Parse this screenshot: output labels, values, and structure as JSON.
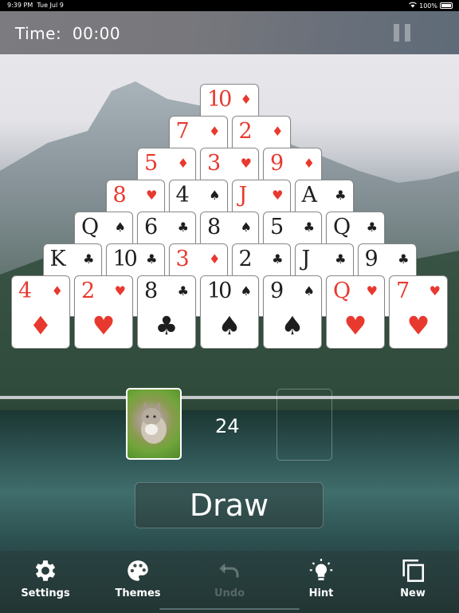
{
  "status_bar": {
    "time": "9:39 PM",
    "date": "Tue Jul 9",
    "battery": "100%"
  },
  "header": {
    "time_label": "Time:",
    "time_value": "00:00"
  },
  "pyramid": {
    "rows": [
      [
        {
          "rank": "10",
          "suit": "♦",
          "color": "red"
        }
      ],
      [
        {
          "rank": "7",
          "suit": "♦",
          "color": "red"
        },
        {
          "rank": "2",
          "suit": "♦",
          "color": "red"
        }
      ],
      [
        {
          "rank": "5",
          "suit": "♦",
          "color": "red"
        },
        {
          "rank": "3",
          "suit": "♥",
          "color": "red"
        },
        {
          "rank": "9",
          "suit": "♦",
          "color": "red"
        }
      ],
      [
        {
          "rank": "8",
          "suit": "♥",
          "color": "red"
        },
        {
          "rank": "4",
          "suit": "♠",
          "color": "black"
        },
        {
          "rank": "J",
          "suit": "♥",
          "color": "red"
        },
        {
          "rank": "A",
          "suit": "♣",
          "color": "black"
        }
      ],
      [
        {
          "rank": "Q",
          "suit": "♠",
          "color": "black"
        },
        {
          "rank": "6",
          "suit": "♣",
          "color": "black"
        },
        {
          "rank": "8",
          "suit": "♠",
          "color": "black"
        },
        {
          "rank": "5",
          "suit": "♣",
          "color": "black"
        },
        {
          "rank": "Q",
          "suit": "♣",
          "color": "black"
        }
      ],
      [
        {
          "rank": "K",
          "suit": "♣",
          "color": "black"
        },
        {
          "rank": "10",
          "suit": "♣",
          "color": "black"
        },
        {
          "rank": "3",
          "suit": "♦",
          "color": "red"
        },
        {
          "rank": "2",
          "suit": "♣",
          "color": "black"
        },
        {
          "rank": "J",
          "suit": "♣",
          "color": "black"
        },
        {
          "rank": "9",
          "suit": "♣",
          "color": "black"
        }
      ],
      [
        {
          "rank": "4",
          "suit": "♦",
          "color": "red"
        },
        {
          "rank": "2",
          "suit": "♥",
          "color": "red"
        },
        {
          "rank": "8",
          "suit": "♣",
          "color": "black"
        },
        {
          "rank": "10",
          "suit": "♠",
          "color": "black"
        },
        {
          "rank": "9",
          "suit": "♠",
          "color": "black"
        },
        {
          "rank": "Q",
          "suit": "♥",
          "color": "red"
        },
        {
          "rank": "7",
          "suit": "♥",
          "color": "red"
        }
      ]
    ]
  },
  "stock": {
    "remaining": "24"
  },
  "draw_button": {
    "label": "Draw"
  },
  "toolbar": {
    "settings": "Settings",
    "themes": "Themes",
    "undo": "Undo",
    "hint": "Hint",
    "new": "New"
  }
}
